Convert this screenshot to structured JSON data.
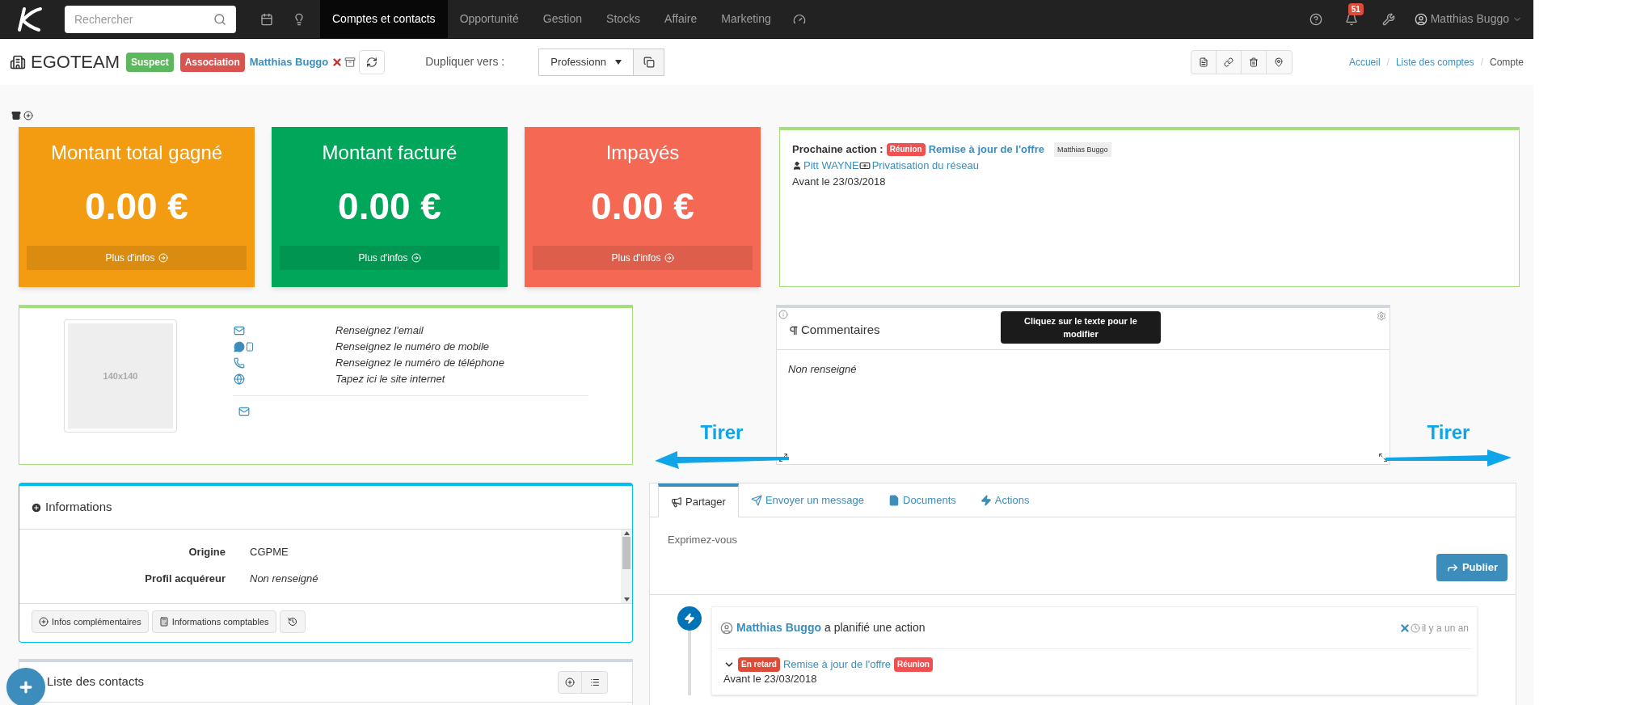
{
  "navbar": {
    "search": {
      "placeholder": "Rechercher"
    },
    "menu": [
      {
        "label": "Comptes et contacts",
        "selected": true
      },
      {
        "label": "Opportunité",
        "selected": false
      },
      {
        "label": "Gestion",
        "selected": false
      },
      {
        "label": "Stocks",
        "selected": false
      },
      {
        "label": "Affaire",
        "selected": false
      },
      {
        "label": "Marketing",
        "selected": false
      }
    ],
    "notifications": "51",
    "user": "Matthias Buggo"
  },
  "header": {
    "title": "EGOTEAM",
    "badges": [
      {
        "label": "Suspect",
        "color": "#5cb85c"
      },
      {
        "label": "Association",
        "color": "#d9534f"
      }
    ],
    "owner": "Matthias Buggo",
    "duplicate_label": "Dupliquer vers :",
    "duplicate_select": "Professionn",
    "breadcrumb_separators": [
      "/",
      "/"
    ],
    "breadcrumbs": [
      {
        "label": "Accueil",
        "kind": "link"
      },
      {
        "label": "Liste des comptes",
        "kind": "link"
      },
      {
        "label": "Compte",
        "kind": "current"
      }
    ]
  },
  "kpi_cards": [
    {
      "title": "Montant total gagné",
      "amount": "0.00 €",
      "link": "Plus d'infos",
      "color": "#f39c12"
    },
    {
      "title": "Montant facturé",
      "amount": "0.00 €",
      "link": "Plus d'infos",
      "color": "#00a65a"
    },
    {
      "title": "Impayés",
      "amount": "0.00 €",
      "link": "Plus d'infos",
      "color": "#f56954"
    }
  ],
  "next_action": {
    "label": "Prochaine action :",
    "type": "Réunion",
    "title": "Remise à jour de l'offre",
    "assignee": "Matthias Buggo",
    "contact": "Pitt WAYNE",
    "project": "Privatisation du réseau",
    "deadline": "Avant le 23/03/2018"
  },
  "contact_card": {
    "photo": "140x140",
    "fields": [
      {
        "kind": "email",
        "value": "Renseignez l'email"
      },
      {
        "kind": "mobile",
        "value": "Renseignez le numéro de mobile"
      },
      {
        "kind": "phone",
        "value": "Renseignez le numéro de téléphone"
      },
      {
        "kind": "website",
        "value": "Tapez ici le site internet"
      }
    ]
  },
  "comments": {
    "title": "Commentaires",
    "tooltip": "Cliquez sur le texte pour le modifier",
    "value": "Non renseigné"
  },
  "annotations": [
    {
      "label": "Tirer"
    },
    {
      "label": "Tirer"
    }
  ],
  "informations": {
    "title": "Informations",
    "rows": [
      {
        "label": "Origine",
        "value": "CGPME",
        "kind": "filled"
      },
      {
        "label": "Profil acquéreur",
        "value": "Non renseigné",
        "kind": "empty"
      }
    ],
    "buttons": [
      "Infos complémentaires",
      "Informations comptables"
    ]
  },
  "contacts": {
    "title": "Liste des contacts"
  },
  "tabs": [
    {
      "label": "Partager",
      "kind": "share",
      "selected": true
    },
    {
      "label": "Envoyer un message",
      "kind": "message",
      "selected": false
    },
    {
      "label": "Documents",
      "kind": "documents",
      "selected": false
    },
    {
      "label": "Actions",
      "kind": "actions",
      "selected": false
    }
  ],
  "composer": {
    "placeholder": "Exprimez-vous",
    "button": "Publier"
  },
  "feed": [
    {
      "author": "Matthias Buggo",
      "text": "a planifié une action",
      "time": "il y a un an",
      "status": "En retard",
      "link": "Remise à jour de l'offre",
      "type": "Réunion",
      "deadline": "Avant le 23/03/2018"
    }
  ]
}
